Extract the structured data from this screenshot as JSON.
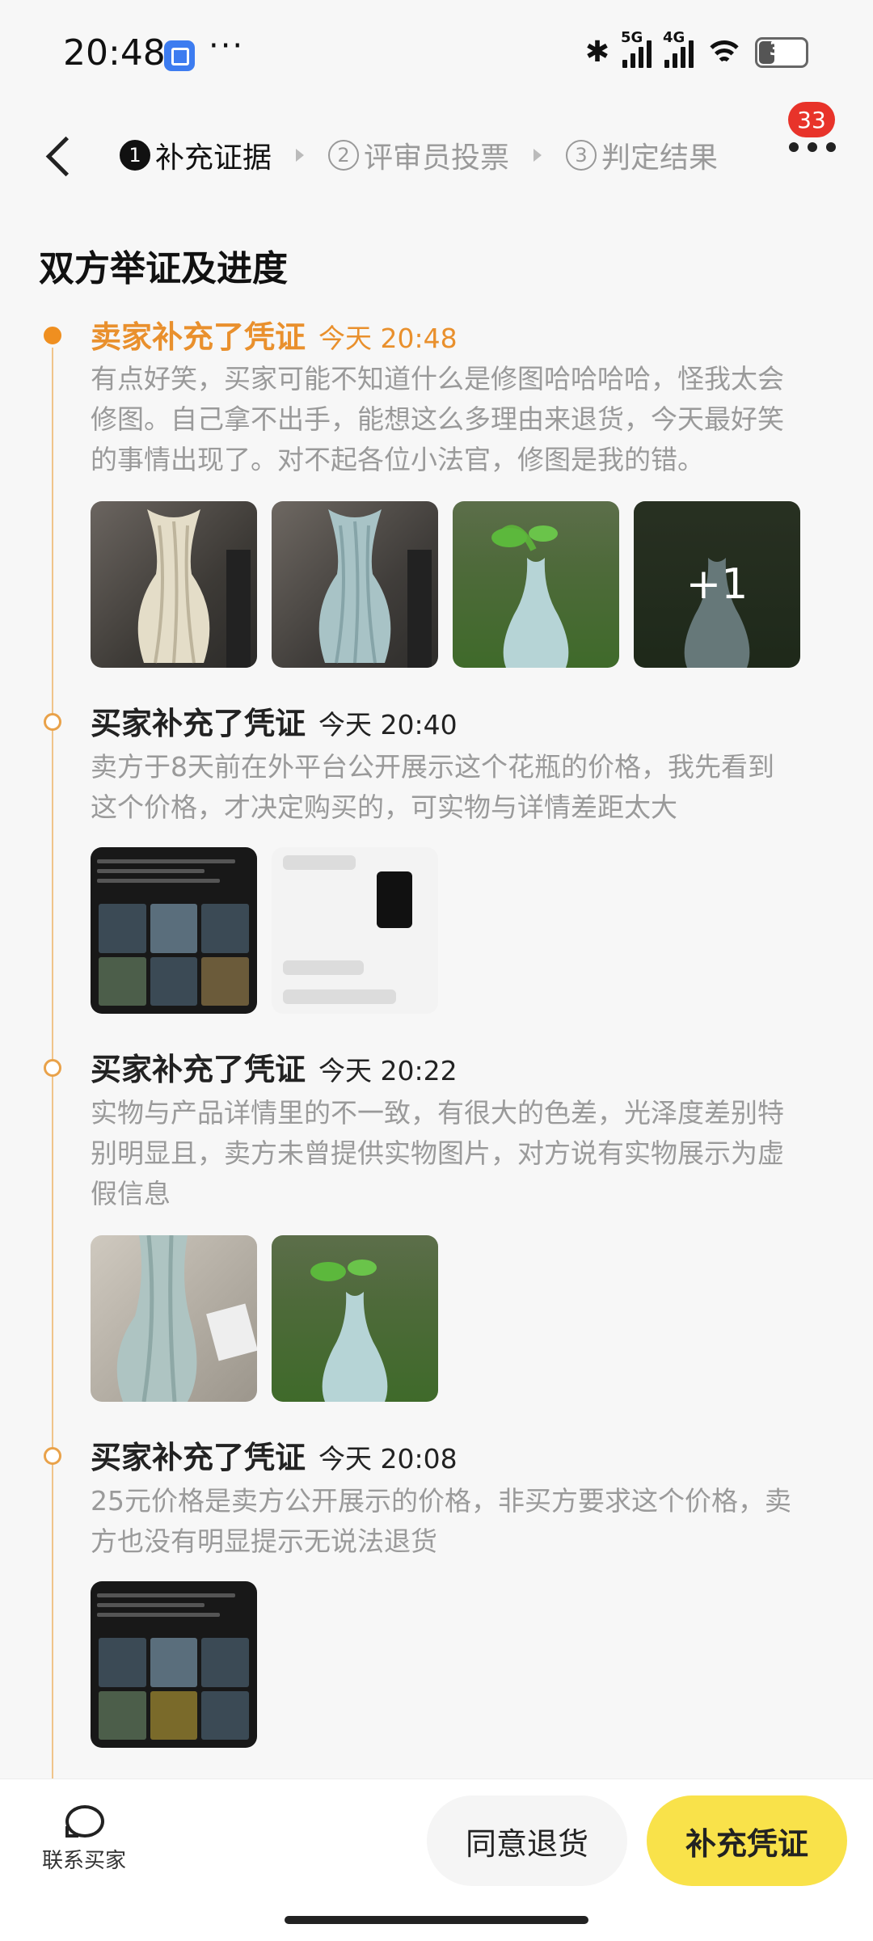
{
  "status_bar": {
    "time": "20:48",
    "more": "···",
    "signal1": "5G",
    "signal2": "4G",
    "battery": "32"
  },
  "header": {
    "badge": "33",
    "steps": [
      {
        "num": "1",
        "label": "补充证据"
      },
      {
        "num": "2",
        "label": "评审员投票"
      },
      {
        "num": "3",
        "label": "判定结果"
      }
    ]
  },
  "section_title": "双方举证及进度",
  "entries": [
    {
      "title": "卖家补充了凭证",
      "time": "今天 20:48",
      "text": "有点好笑，买家可能不知道什么是修图哈哈哈哈，怪我太会修图。自己拿不出手，能想这么多理由来退货，今天最好笑的事情出现了。对不起各位小法官，修图是我的错。",
      "more_count": "+1"
    },
    {
      "title": "买家补充了凭证",
      "time": "今天 20:40",
      "text": "卖方于8天前在外平台公开展示这个花瓶的价格，我先看到这个价格，才决定购买的，可实物与详情差距太大"
    },
    {
      "title": "买家补充了凭证",
      "time": "今天 20:22",
      "text": "实物与产品详情里的不一致，有很大的色差，光泽度差别特别明显且，卖方未曾提供实物图片，对方说有实物展示为虚假信息"
    },
    {
      "title": "买家补充了凭证",
      "time": "今天 20:08",
      "text": "25元价格是卖方公开展示的价格，非买方要求这个价格，卖方也没有明显提示无说法退货"
    }
  ],
  "bottom": {
    "contact_label": "联系买家",
    "agree_label": "同意退货",
    "supplement_label": "补充凭证"
  },
  "colors": {
    "accent": "#ef8f20",
    "primary_button": "#f9e24a",
    "badge": "#e8332a"
  }
}
